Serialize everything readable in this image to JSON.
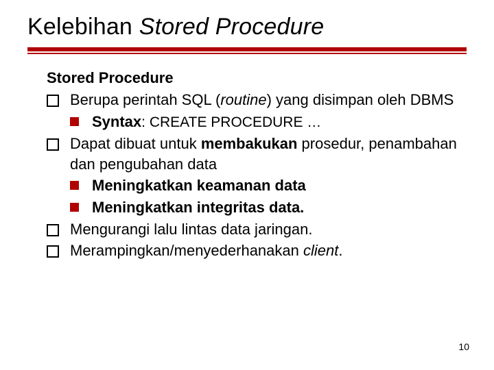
{
  "title_plain": "Kelebihan ",
  "title_italic": "Stored Procedure",
  "subtitle": "Stored Procedure",
  "items": [
    {
      "pre": "Berupa perintah SQL (",
      "em": "routine",
      "post": ") yang disimpan oleh DBMS",
      "sub": [
        {
          "bold": "Syntax",
          "rest": ": CREATE PROCEDURE …",
          "restClass": "sc"
        }
      ]
    },
    {
      "pre": "Dapat dibuat untuk ",
      "bold": "membakukan",
      "post": " prosedur, penambahan dan pengubahan data",
      "sub": [
        {
          "bold": "Meningkatkan keamanan data"
        },
        {
          "bold": "Meningkatkan integritas data."
        }
      ]
    },
    {
      "text": "Mengurangi lalu lintas data jaringan."
    },
    {
      "pre": "Merampingkan/menyederhanakan ",
      "em": "client",
      "post": "."
    }
  ],
  "page_number": "10"
}
